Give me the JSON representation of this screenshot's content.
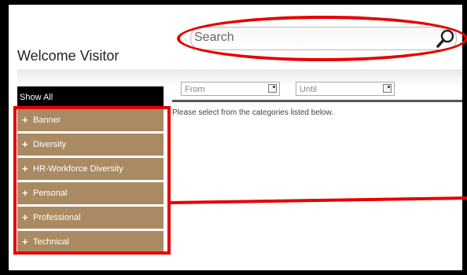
{
  "header": {
    "welcome_text": "Welcome Visitor"
  },
  "search": {
    "placeholder": "Search",
    "icon": "magnifier-icon"
  },
  "filters": {
    "from_value": "From",
    "until_value": "Until"
  },
  "sidebar": {
    "show_all_label": "Show All",
    "items": [
      {
        "label": "Banner"
      },
      {
        "label": "Diversity"
      },
      {
        "label": "HR-Workforce Diversity"
      },
      {
        "label": "Personal"
      },
      {
        "label": "Professional"
      },
      {
        "label": "Technical"
      }
    ]
  },
  "content": {
    "instruction": "Please select from the categories listed below."
  },
  "colors": {
    "category_bg": "#aa8a62",
    "highlight": "#e60000",
    "show_all_bg": "#000000"
  }
}
